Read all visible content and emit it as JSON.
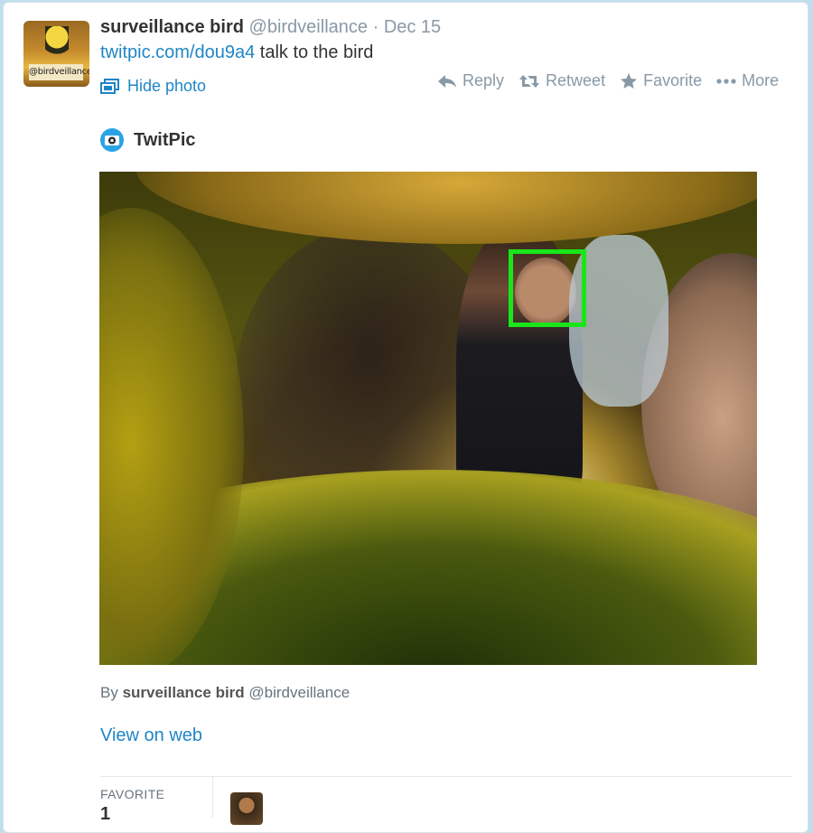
{
  "tweet": {
    "display_name": "surveillance bird",
    "handle": "@birdveillance",
    "separator": "·",
    "date": "Dec 15",
    "link": "twitpic.com/dou9a4",
    "text": " talk to the bird",
    "hide_photo": "Hide photo",
    "avatar_sign": "@birdveillance"
  },
  "actions": [
    {
      "label": "Reply",
      "icon": "reply-icon"
    },
    {
      "label": "Retweet",
      "icon": "retweet-icon"
    },
    {
      "label": "Favorite",
      "icon": "star-icon"
    },
    {
      "label": "More",
      "icon": "more-dots-icon"
    }
  ],
  "media_card": {
    "provider": "TwitPic",
    "by_prefix": "By ",
    "by_name": "surveillance bird",
    "by_handle": " @birdveillance",
    "view_on_web": "View on web"
  },
  "stats": {
    "favorite_label": "FAVORITE",
    "favorite_count": "1"
  },
  "colors": {
    "link": "#1f86c6",
    "muted": "#8899a6",
    "face_box": "#19e619",
    "background": "#c0deed"
  }
}
